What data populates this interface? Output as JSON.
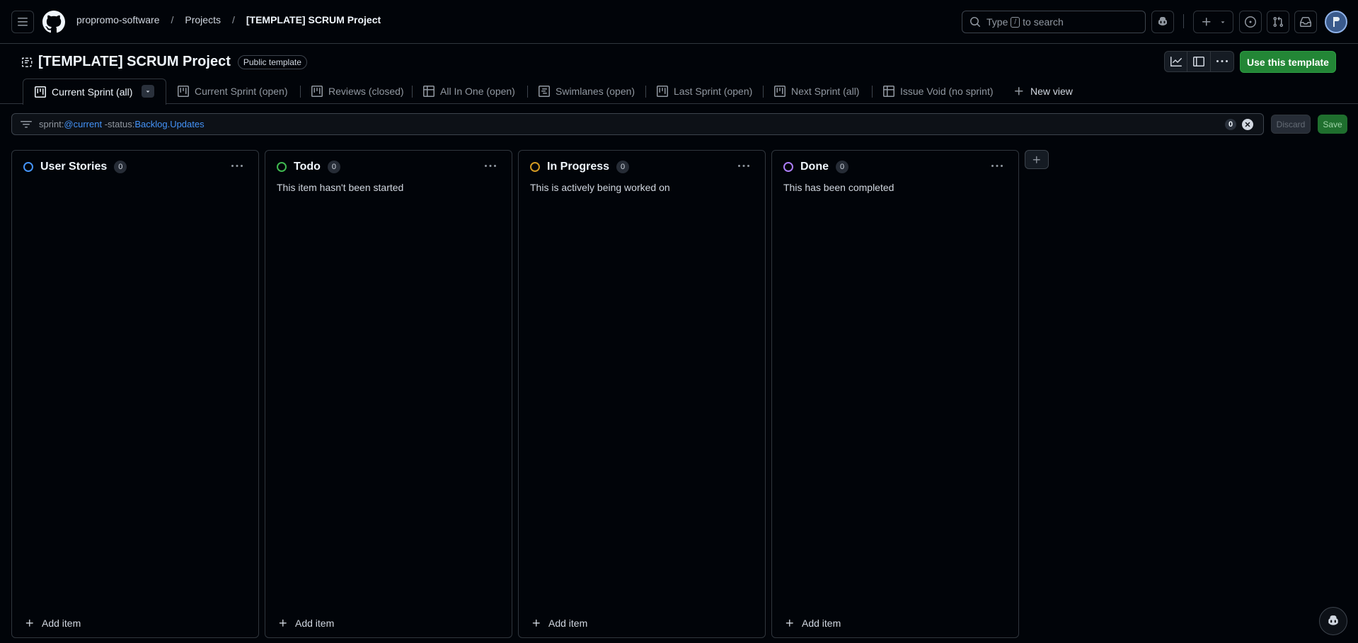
{
  "header": {
    "breadcrumb": [
      "propromo-software",
      "Projects",
      "[TEMPLATE] SCRUM Project"
    ],
    "search": {
      "prefix": "Type",
      "key": "/",
      "suffix": "to search"
    }
  },
  "project": {
    "title": "[TEMPLATE] SCRUM Project",
    "badge": "Public template",
    "use_template_label": "Use this template"
  },
  "views": [
    {
      "label": "Current Sprint (all)",
      "icon": "board-icon",
      "active": true
    },
    {
      "label": "Current Sprint (open)",
      "icon": "board-icon"
    },
    {
      "label": "Reviews (closed)",
      "icon": "board-icon"
    },
    {
      "label": "All In One (open)",
      "icon": "table-icon"
    },
    {
      "label": "Swimlanes (open)",
      "icon": "roadmap-icon"
    },
    {
      "label": "Last Sprint (open)",
      "icon": "board-icon"
    },
    {
      "label": "Next Sprint (all)",
      "icon": "board-icon"
    },
    {
      "label": "Issue Void (no sprint)",
      "icon": "table-icon"
    }
  ],
  "new_view_label": "New view",
  "filter": {
    "key1": "sprint:",
    "val1": "@current",
    "key2": " -status:",
    "val2": "Backlog.Updates",
    "count": "0",
    "discard_label": "Discard",
    "save_label": "Save"
  },
  "columns": [
    {
      "title": "User Stories",
      "count": "0",
      "description": "",
      "color": "#4493f8",
      "add_label": "Add item"
    },
    {
      "title": "Todo",
      "count": "0",
      "description": "This item hasn't been started",
      "color": "#3fb950",
      "add_label": "Add item"
    },
    {
      "title": "In Progress",
      "count": "0",
      "description": "This is actively being worked on",
      "color": "#d29922",
      "add_label": "Add item"
    },
    {
      "title": "Done",
      "count": "0",
      "description": "This has been completed",
      "color": "#ab7df8",
      "add_label": "Add item"
    }
  ]
}
